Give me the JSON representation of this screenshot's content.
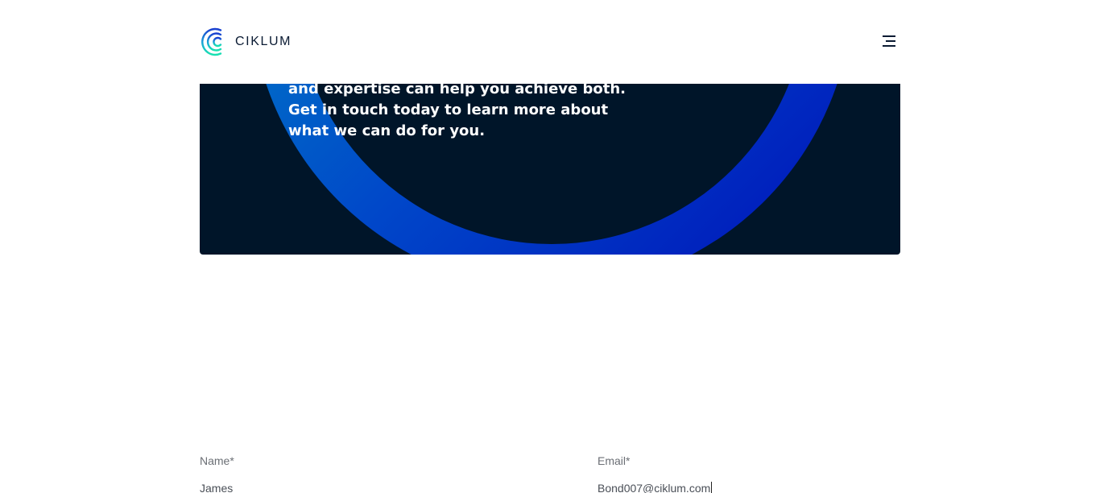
{
  "header": {
    "logo_text": "CIKLUM",
    "logo_icon": "ciklum-logo-icon",
    "menu_icon": "hamburger-menu-icon"
  },
  "hero": {
    "text": "and expertise can help you achieve both. Get in touch today to learn more about what we can do for you.",
    "background_color": "#001529",
    "accent_gradient": [
      "#0097c4",
      "#0019c2"
    ]
  },
  "form": {
    "name": {
      "label": "Name*",
      "value": "James"
    },
    "email": {
      "label": "Email*",
      "value": "Bond007@ciklum.com"
    }
  }
}
